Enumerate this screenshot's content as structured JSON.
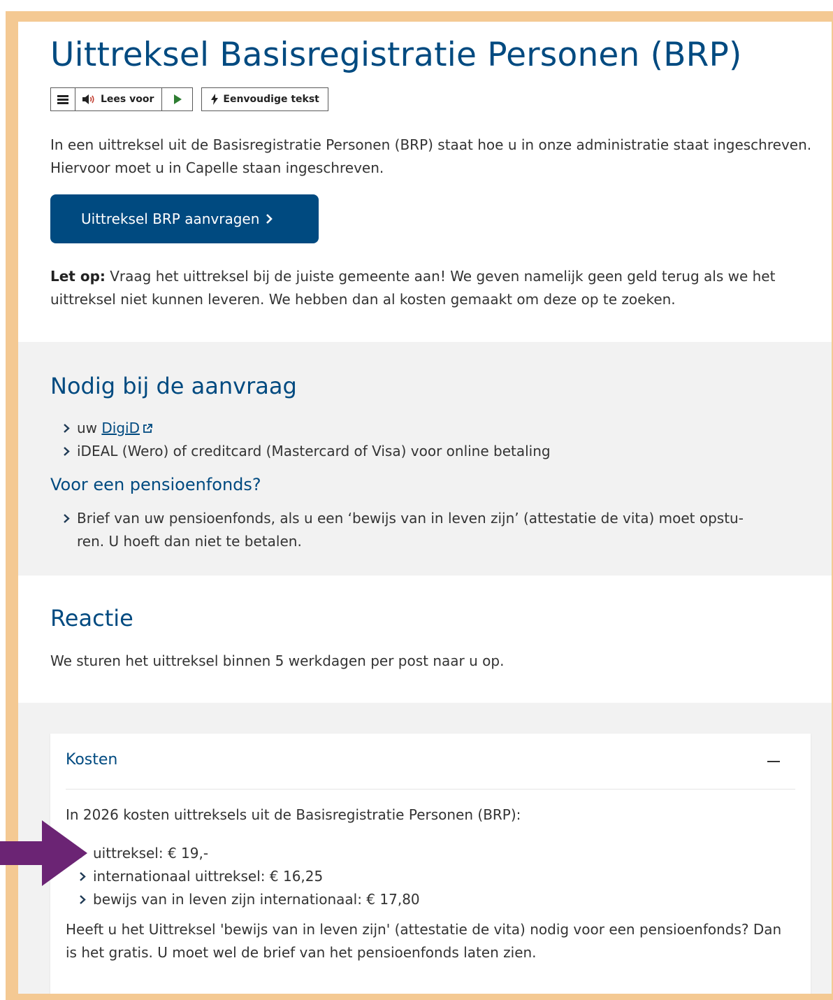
{
  "title": "Uittreksel Basisregistratie Personen (BRP)",
  "readspeaker": {
    "menu_icon": "menu-icon",
    "read_label": "Lees voor",
    "play_icon": "play-icon",
    "simple_label": "Eenvoudige tekst"
  },
  "intro": {
    "text": "In een uittreksel uit de Basisregistratie Personen (BRP) staat hoe u in onze administratie staat ingeschreven. Hiervoor moet u in Capelle staan ingeschreven.",
    "cta_label": "Uittreksel BRP aanvragen",
    "notice_bold": "Let op:",
    "notice_text": " Vraag het uittreksel bij de juiste gemeente aan! We geven namelijk geen geld terug als we het uittreksel niet kunnen leveren. We hebben dan al kosten gemaakt om deze op te zoeken."
  },
  "needed": {
    "heading": "Nodig bij de aanvraag",
    "item1_prefix": "uw ",
    "item1_link": "DigiD",
    "item2": "iDEAL (Wero) of creditcard (Mastercard of Visa) voor online betaling",
    "pension_heading": "Voor een pensioenfonds?",
    "pension_item_line1": "Brief van uw pensioenfonds, als u een ‘bewijs van in leven zijn’ (attestatie de vita) moet opstu-",
    "pension_item_line2": "ren. U hoeft dan niet te betalen."
  },
  "reaction": {
    "heading": "Reactie",
    "text": "We sturen het uittreksel binnen 5 werkdagen per post naar u op."
  },
  "costs": {
    "heading": "Kosten",
    "intro": "In 2026 kosten uittreksels uit de Basisregistratie Personen (BRP):",
    "items": [
      "uittreksel: € 19,-",
      "internationaal uittreksel: € 16,25",
      "bewijs van in leven zijn internationaal: € 17,80"
    ],
    "footer": "Heeft u het Uittreksel 'bewijs van in leven zijn' (attestatie de vita) nodig voor een pensioenfonds? Dan is het gratis. U moet wel de brief van het pensioenfonds laten zien."
  },
  "colors": {
    "brand": "#004a80",
    "frame": "#f4c993",
    "arrow": "#6b2474",
    "section_bg": "#f2f2f2"
  }
}
